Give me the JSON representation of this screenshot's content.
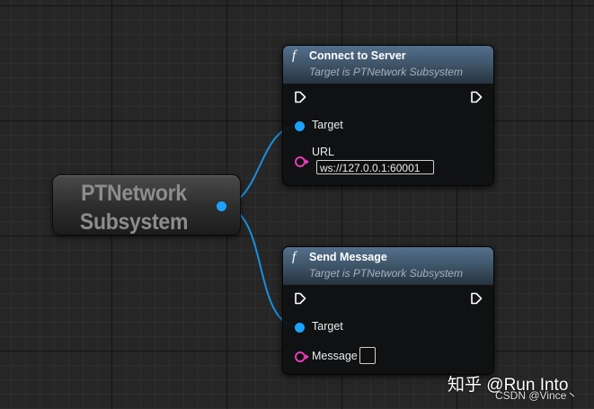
{
  "pure_node": {
    "title_line1": "PTNetwork",
    "title_line2": "Subsystem"
  },
  "nodes": [
    {
      "icon": "f",
      "title": "Connect to Server",
      "subtitle": "Target is PTNetwork Subsystem",
      "pins": {
        "target_label": "Target",
        "param_label": "URL",
        "param_value": "ws://127.0.0.1:60001"
      }
    },
    {
      "icon": "f",
      "title": "Send Message",
      "subtitle": "Target is PTNetwork Subsystem",
      "pins": {
        "target_label": "Target",
        "param_label": "Message",
        "param_value": ""
      }
    }
  ],
  "colors": {
    "object_pin": "#1aa3ff",
    "string_pin": "#e63db8",
    "header_blue": "#3f5468"
  },
  "watermarks": {
    "zhihu": "知乎 @Run Into",
    "csdn": "CSDN @Vince丶"
  }
}
